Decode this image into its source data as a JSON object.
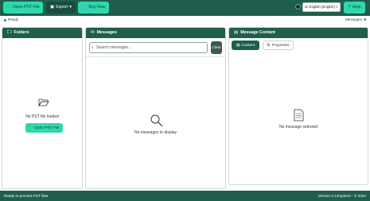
{
  "toolbar": {
    "open_pst_label": "Open PST File",
    "export_label": "Export",
    "buy_now_label": "Buy Now",
    "language_value": "us English (English)",
    "help_label": "Help"
  },
  "status": {
    "ready": "Ready",
    "messages_label": "Messages:",
    "messages_count": "0"
  },
  "panels": {
    "folders": {
      "title": "Folders",
      "empty_text": "No PST file loaded",
      "open_button": "Open PST File"
    },
    "messages": {
      "title": "Messages",
      "search_placeholder": "Search messages...",
      "clear_label": "Clear",
      "empty_text": "No messages to display"
    },
    "content": {
      "title": "Message Content",
      "tab_content": "Content",
      "tab_properties": "Properties",
      "empty_text": "No message selected"
    }
  },
  "footer": {
    "left": "Ready to process PST files",
    "right": "Version 2.3 Explorer · © 2024"
  },
  "colors": {
    "header_green": "#1f5e4d",
    "accent_mint": "#2fd8ad"
  },
  "icons": [
    "folder-open-icon",
    "chevron-down-icon",
    "cart-icon",
    "globe-icon",
    "help-icon",
    "folder-icon",
    "envelope-icon",
    "search-icon",
    "magnifier-icon",
    "content-icon",
    "gear-icon",
    "document-icon"
  ]
}
